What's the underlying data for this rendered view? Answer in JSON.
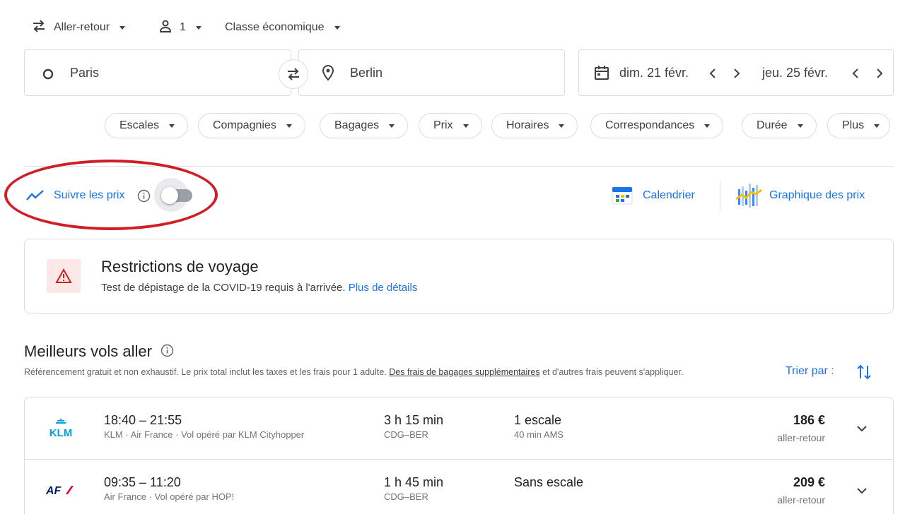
{
  "search": {
    "trip_type": "Aller-retour",
    "passengers": "1",
    "cabin_class": "Classe économique",
    "origin": "Paris",
    "destination": "Berlin",
    "departure_date": "dim. 21 févr.",
    "return_date": "jeu. 25 févr."
  },
  "filters": [
    "Escales",
    "Compagnies",
    "Bagages",
    "Prix",
    "Horaires",
    "Correspondances",
    "Durée",
    "Plus"
  ],
  "tracking": {
    "label": "Suivre les prix",
    "enabled": false
  },
  "tools": {
    "calendar": "Calendrier",
    "price_graph": "Graphique des prix"
  },
  "restrictions": {
    "title": "Restrictions de voyage",
    "text": "Test de dépistage de la COVID-19 requis à l'arrivée.",
    "link": "Plus de détails"
  },
  "results": {
    "title": "Meilleurs vols aller",
    "disclaimer_pre": "Référencement gratuit et non exhaustif. Le prix total inclut les taxes et les frais pour 1 adulte.",
    "disclaimer_link": "Des frais de bagages supplémentaires",
    "disclaimer_post": "et d'autres frais peuvent s'appliquer.",
    "sort_label": "Trier par :",
    "flights": [
      {
        "airline_logo": "KLM",
        "times": "18:40 – 21:55",
        "carriers": "KLM · Air France · Vol opéré par KLM Cityhopper",
        "duration": "3 h 15 min",
        "route": "CDG–BER",
        "stops": "1 escale",
        "stop_detail": "40 min AMS",
        "price": "186 €",
        "price_type": "aller-retour"
      },
      {
        "airline_logo": "AF",
        "times": "09:35 – 11:20",
        "carriers": "Air France · Vol opéré par HOP!",
        "duration": "1 h 45 min",
        "route": "CDG–BER",
        "stops": "Sans escale",
        "stop_detail": "",
        "price": "209 €",
        "price_type": "aller-retour"
      }
    ]
  },
  "colors": {
    "accent": "#1a73e8",
    "highlight_circle": "#d11e26",
    "warning": "#c5221f"
  }
}
